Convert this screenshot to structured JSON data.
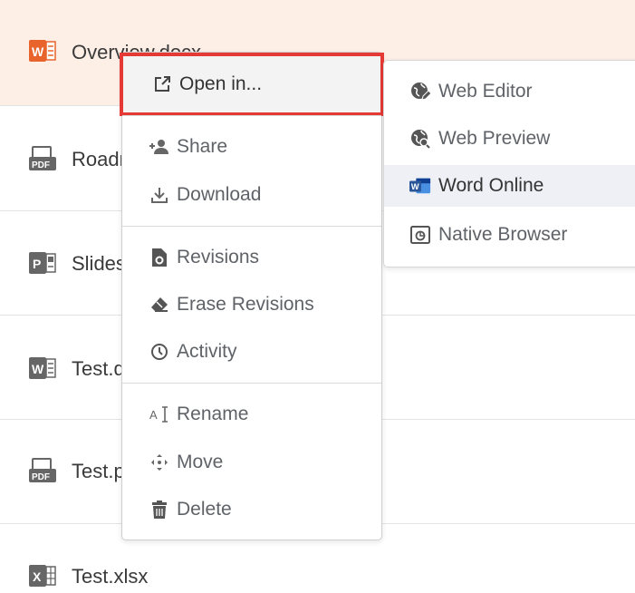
{
  "files": [
    {
      "name": "Overview.docx",
      "icon": "word-file-icon",
      "selected": true
    },
    {
      "name": "Roadmap.pdf",
      "icon": "pdf-file-icon"
    },
    {
      "name": "Slides.pptx",
      "icon": "powerpoint-file-icon"
    },
    {
      "name": "Test.docx",
      "icon": "word-file-icon"
    },
    {
      "name": "Test.pdf",
      "icon": "pdf-file-icon"
    },
    {
      "name": "Test.xlsx",
      "icon": "excel-file-icon"
    }
  ],
  "context_menu": {
    "open_in": "Open in...",
    "share": "Share",
    "download": "Download",
    "revisions": "Revisions",
    "erase_revisions": "Erase Revisions",
    "activity": "Activity",
    "rename": "Rename",
    "move": "Move",
    "delete": "Delete"
  },
  "submenu": {
    "web_editor": "Web Editor",
    "web_preview": "Web Preview",
    "word_online": "Word Online",
    "native_browser": "Native Browser"
  },
  "colors": {
    "selected_row": "#fdeee6",
    "highlight_outline": "#e53935",
    "word_blue": "#2b579a",
    "pdf_gray": "#666666",
    "office_orange": "#e8642c"
  }
}
